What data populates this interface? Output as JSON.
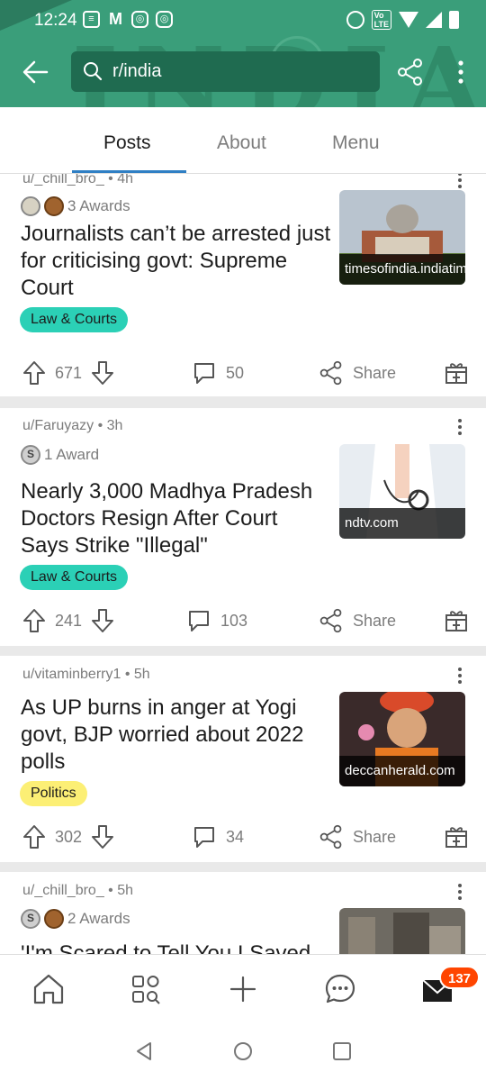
{
  "statusbar": {
    "time": "12:24"
  },
  "header": {
    "search_value": "r/india"
  },
  "tabs": [
    {
      "label": "Posts"
    },
    {
      "label": "About"
    },
    {
      "label": "Menu"
    }
  ],
  "posts": [
    {
      "author": "u/_chill_bro_ • 4h",
      "awards": "3 Awards",
      "title": "Journalists can’t be arrested just for criticising govt: Supreme Court",
      "flair": "Law & Courts",
      "thumb_label": "timesofindia.indiatimes.com",
      "votes": "671",
      "comments": "50",
      "share": "Share"
    },
    {
      "author": "u/Faruyazy • 3h",
      "awards": "1 Award",
      "title": "Nearly 3,000 Madhya Pradesh Doctors Resign After Court Says Strike \"Illegal\"",
      "flair": "Law & Courts",
      "thumb_label": "ndtv.com",
      "votes": "241",
      "comments": "103",
      "share": "Share"
    },
    {
      "author": "u/vitaminberry1 • 5h",
      "title": "As UP burns in anger at Yogi govt, BJP worried about 2022 polls",
      "flair": "Politics",
      "thumb_label": "deccanherald.com",
      "votes": "302",
      "comments": "34",
      "share": "Share"
    },
    {
      "author": "u/_chill_bro_ • 5h",
      "awards": "2 Awards",
      "title": "'I'm Scared to Tell You I Saved"
    }
  ],
  "bottomnav": {
    "inbox_badge": "137"
  },
  "colors": {
    "header_green": "#3a9e7a",
    "search_bg": "#1f6b50",
    "tab_accent": "#2f7fc4",
    "flair_law": "#2bd0b6",
    "flair_politics": "#fcef75",
    "badge": "#ff4500"
  }
}
